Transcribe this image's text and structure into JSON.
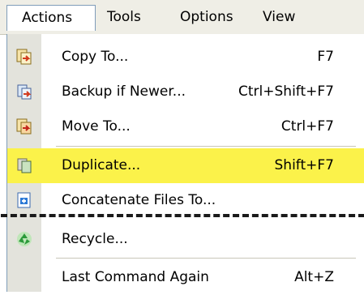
{
  "menubar": {
    "items": [
      {
        "label": "Actions",
        "mnemonic_index": 0,
        "open": true
      },
      {
        "label": "Tools"
      },
      {
        "label": "Options"
      },
      {
        "label": "View"
      }
    ]
  },
  "menu": {
    "items": [
      {
        "label": "Copy To...",
        "shortcut": "F7",
        "icon": "copy-file-icon"
      },
      {
        "label": "Backup if Newer...",
        "shortcut": "Ctrl+Shift+F7",
        "icon": "backup-file-icon"
      },
      {
        "label": "Move To...",
        "shortcut": "Ctrl+F7",
        "icon": "move-file-icon"
      },
      {
        "label": "Duplicate...",
        "shortcut": "Shift+F7",
        "icon": "duplicate-icon",
        "highlighted": true
      },
      {
        "label": "Concatenate Files To...",
        "shortcut": "",
        "icon": "concatenate-icon"
      },
      {
        "label": "Recycle...",
        "shortcut": "",
        "icon": "recycle-icon"
      },
      {
        "label": "Last Command Again",
        "shortcut": "Alt+Z",
        "icon": ""
      }
    ]
  },
  "colors": {
    "menubar_bg": "#efeee6",
    "highlight": "#fbf24a",
    "icon_strip": "#e3e3dc",
    "border": "#7f9db9"
  }
}
